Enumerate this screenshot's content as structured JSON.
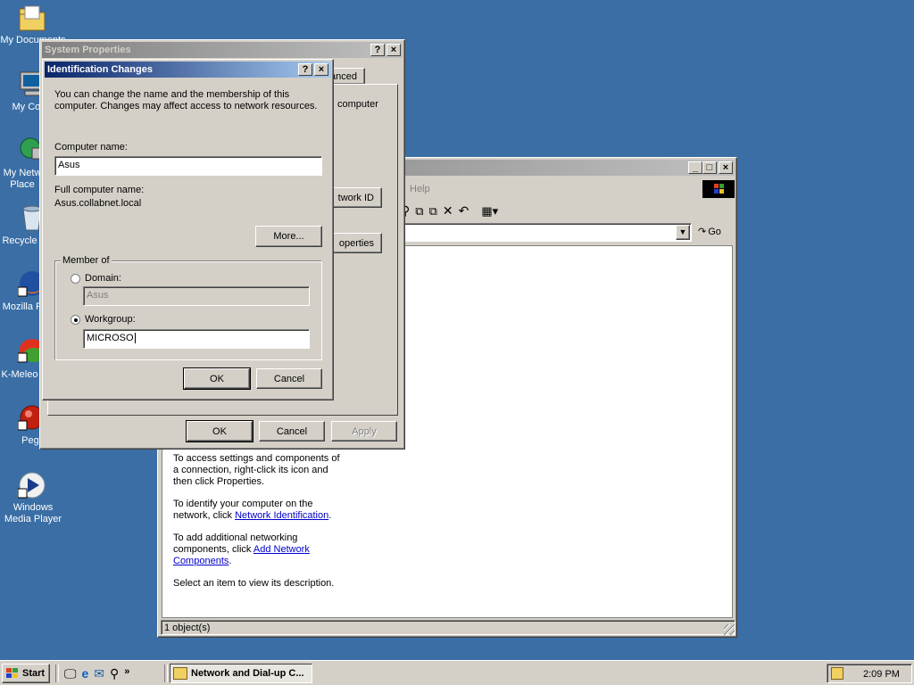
{
  "desktop": {
    "icons": [
      {
        "label": "My Documents",
        "icon": "folder-documents-icon"
      },
      {
        "label": "My Comp",
        "icon": "computer-icon"
      },
      {
        "label": "My Netw Place",
        "icon": "network-places-icon"
      },
      {
        "label": "Recycle",
        "icon": "recycle-bin-icon"
      },
      {
        "label": "Mozilla Fi",
        "icon": "firefox-icon"
      },
      {
        "label": "K-Meleo",
        "icon": "k-meleon-icon"
      },
      {
        "label": "Pega",
        "icon": "pegasus-icon"
      },
      {
        "label": "Windows Media Player",
        "icon": "media-player-icon"
      }
    ]
  },
  "network_window": {
    "menu_help": "Help",
    "address_go": "Go",
    "info_text_1": "To access settings and components of a connection, right-click its icon and then click Properties.",
    "info_text_2_prefix": "To identify your computer on the network, click ",
    "info_link_2": "Network Identification",
    "info_text_2_suffix": ".",
    "info_text_3_prefix": "To add additional networking components, click ",
    "info_link_3": "Add Network Components",
    "info_text_3_suffix": ".",
    "info_text_4": "Select an item to view its description.",
    "status": "1 object(s)"
  },
  "system_properties": {
    "title": "System Properties",
    "tab_advanced_partial": "anced",
    "text_computer_partial": "computer",
    "network_id_partial": "twork ID",
    "properties_partial": "operties",
    "ok": "OK",
    "cancel": "Cancel",
    "apply": "Apply"
  },
  "identification_dialog": {
    "title": "Identification Changes",
    "intro": "You can change the name and the membership of this computer. Changes may affect access to network resources.",
    "computer_name_label": "Computer name:",
    "computer_name_value": "Asus",
    "full_name_label": "Full computer name:",
    "full_name_value": "Asus.collabnet.local",
    "more_button": "More...",
    "member_of_label": "Member of",
    "domain_label": "Domain:",
    "domain_value": "Asus",
    "workgroup_label": "Workgroup:",
    "workgroup_value": "MICROSO",
    "ok": "OK",
    "cancel": "Cancel"
  },
  "taskbar": {
    "start": "Start",
    "task_label": "Network and Dial-up C...",
    "clock": "2:09 PM"
  }
}
